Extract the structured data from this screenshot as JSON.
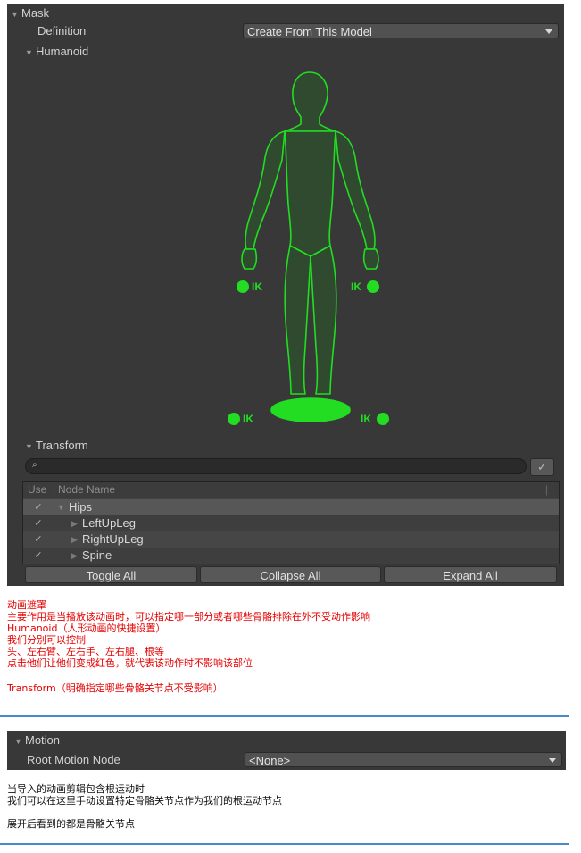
{
  "mask": {
    "header": "Mask",
    "definition_label": "Definition",
    "definition_value": "Create From This Model",
    "humanoid_label": "Humanoid",
    "ik_label": "IK",
    "figure_color": "#22dd22",
    "transform": {
      "header": "Transform",
      "columns": [
        "Use",
        "Node Name"
      ],
      "rows": [
        {
          "name": "Hips",
          "checked": true,
          "expanded": true
        },
        {
          "name": "LeftUpLeg",
          "checked": true,
          "expanded": false
        },
        {
          "name": "RightUpLeg",
          "checked": true,
          "expanded": false
        },
        {
          "name": "Spine",
          "checked": true,
          "expanded": false
        }
      ],
      "toggle_all": "Toggle All",
      "collapse_all": "Collapse All",
      "expand_all": "Expand All"
    }
  },
  "notes1": [
    "动画遮罩",
    "主要作用是当播放该动画时，可以指定哪一部分或者哪些骨骼排除在外不受动作影响",
    "Humanoid（人形动画的快捷设置）",
    "我们分别可以控制",
    "头、左右臂、左右手、左右腿、根等",
    "点击他们让他们变成红色，就代表该动作时不影响该部位",
    "",
    "Transform（明确指定哪些骨骼关节点不受影响）"
  ],
  "motion": {
    "header": "Motion",
    "root_label": "Root Motion Node",
    "root_value": "<None>"
  },
  "notes2": [
    "当导入的动画剪辑包含根运动时",
    "我们可以在这里手动设置特定骨骼关节点作为我们的根运动节点",
    "",
    "展开后看到的都是骨骼关节点"
  ]
}
